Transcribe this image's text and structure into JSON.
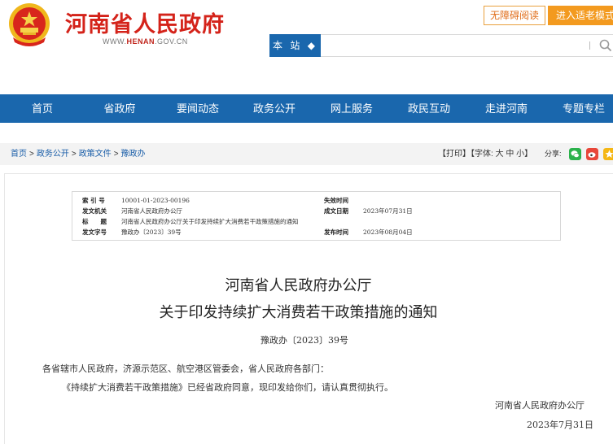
{
  "header": {
    "site_name": "河南省人民政府",
    "site_url_prefix": "WWW.",
    "site_url_highlight": "HENAN",
    "site_url_suffix": ".GOV.CN",
    "accessibility_label": "无障碍阅读",
    "elder_mode_label": "进入适老模式",
    "search": {
      "scope_label": "本 站 ◆",
      "placeholder": "",
      "icon": "search-icon"
    }
  },
  "nav": {
    "items": [
      {
        "label": "首页"
      },
      {
        "label": "省政府"
      },
      {
        "label": "要闻动态"
      },
      {
        "label": "政务公开"
      },
      {
        "label": "网上服务"
      },
      {
        "label": "政民互动"
      },
      {
        "label": "走进河南"
      },
      {
        "label": "专题专栏"
      }
    ]
  },
  "breadcrumb": {
    "items": [
      "首页",
      "政务公开",
      "政策文件",
      "豫政办"
    ],
    "separator": ">"
  },
  "tools": {
    "print": "【打印】",
    "font_prefix": "【字体:",
    "font_large": "大",
    "font_medium": "中",
    "font_small": "小",
    "font_suffix": "】",
    "share_label": "分享:",
    "share_icons": [
      "wechat-icon",
      "weibo-icon",
      "qzone-icon"
    ]
  },
  "meta": {
    "index_label": "索 引 号",
    "index_value": "10001-01-2023-00196",
    "issuer_label": "发文机关",
    "issuer_value": "河南省人民政府办公厅",
    "title_label": "标　　题",
    "title_value": "河南省人民政府办公厅关于印发持续扩大消费若干政策措施的通知",
    "docno_label": "发文字号",
    "docno_value": "豫政办〔2023〕39号",
    "valid_label": "失效时间",
    "valid_value": "",
    "created_label": "成文日期",
    "created_value": "2023年07月31日",
    "published_label": "发布时间",
    "published_value": "2023年08月04日"
  },
  "document": {
    "title_line1": "河南省人民政府办公厅",
    "title_line2": "关于印发持续扩大消费若干政策措施的通知",
    "doc_number": "豫政办〔2023〕39号",
    "addressee": "各省辖市人民政府，济源示范区、航空港区管委会，省人民政府各部门：",
    "body": "《持续扩大消费若干政策措施》已经省政府同意，现印发给你们，请认真贯彻执行。",
    "signature": "河南省人民政府办公厅",
    "date": "2023年7月31日"
  },
  "colors": {
    "brand_red": "#d4231a",
    "nav_blue": "#1a67ad",
    "accent_orange": "#f39a1f"
  }
}
